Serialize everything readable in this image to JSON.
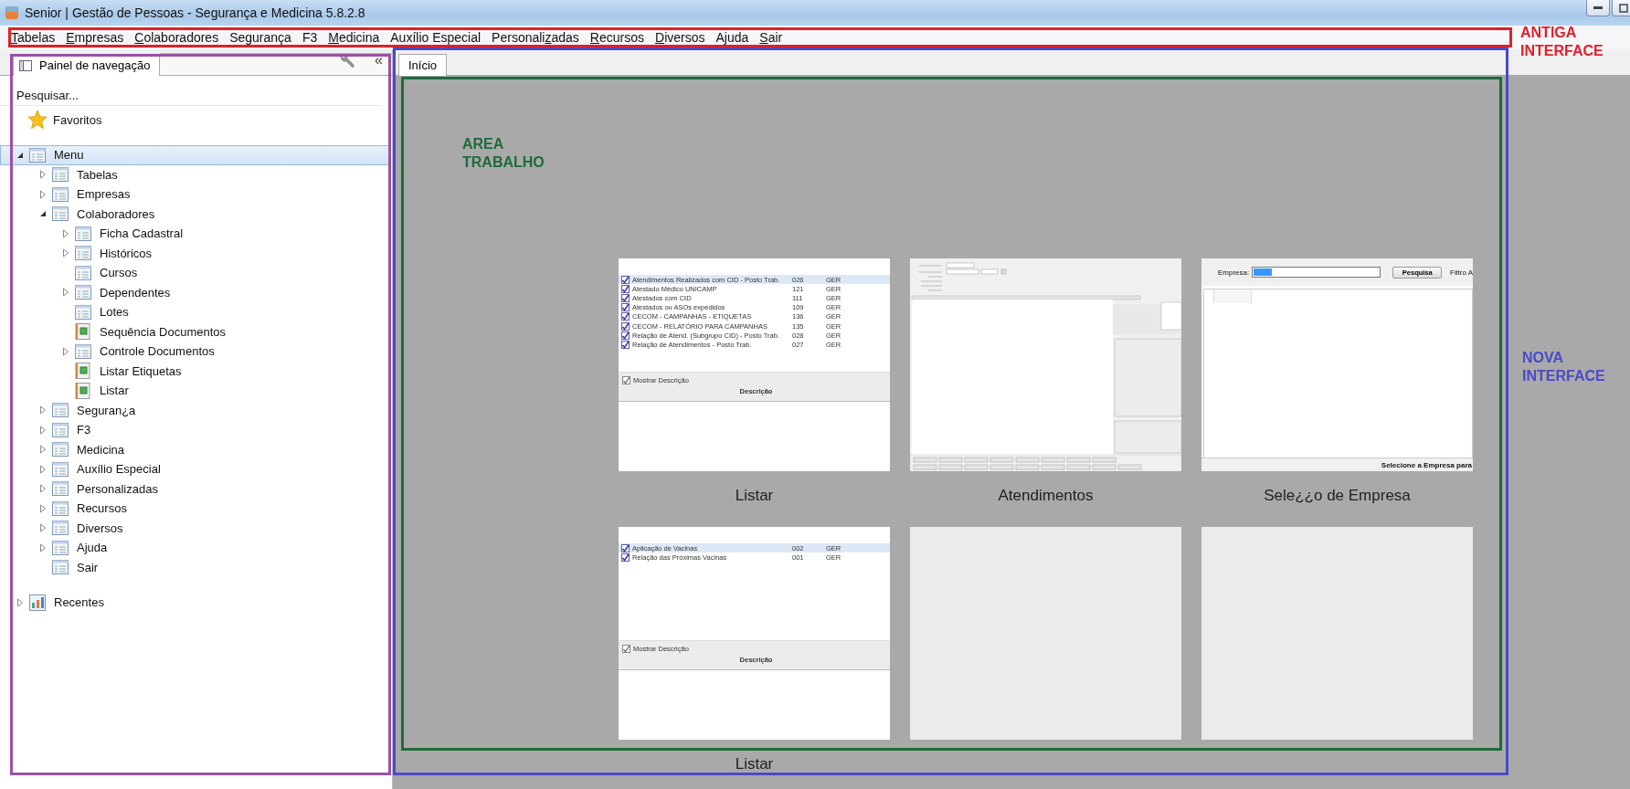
{
  "window": {
    "title": "Senior | Gestão de Pessoas - Segurança e Medicina 5.8.2.8"
  },
  "menubar": [
    {
      "key": "T",
      "after": "abelas"
    },
    {
      "key": "E",
      "after": "mpresas"
    },
    {
      "key": "C",
      "after": "olaboradores"
    },
    {
      "before": "Se",
      "key": "g",
      "after": "urança"
    },
    {
      "before": "F3"
    },
    {
      "key": "M",
      "after": "edicina"
    },
    {
      "before": "Auxílio Especial"
    },
    {
      "before": "Personali",
      "key": "z",
      "after": "adas"
    },
    {
      "key": "R",
      "after": "ecursos"
    },
    {
      "key": "D",
      "after": "iversos"
    },
    {
      "before": "A",
      "key": "j",
      "after": "uda"
    },
    {
      "key": "S",
      "after": "air"
    }
  ],
  "nav_panel": {
    "tab": "Painel de navegação",
    "collapse": "«",
    "search": {
      "placeholder": "Pesquisar..."
    },
    "favorites": "Favoritos",
    "tree": [
      {
        "label": "Menu",
        "kind": "branch",
        "expanded": true,
        "selected": true,
        "children": [
          {
            "label": "Tabelas",
            "kind": "branch",
            "expanded": false,
            "selected": false
          },
          {
            "label": "Empresas",
            "kind": "branch",
            "expanded": false,
            "selected": false
          },
          {
            "label": "Colaboradores",
            "kind": "branch",
            "expanded": true,
            "selected": false,
            "children": [
              {
                "label": "Ficha Cadastral",
                "kind": "branch",
                "expanded": false,
                "selected": false
              },
              {
                "label": "Históricos",
                "kind": "branch",
                "expanded": false,
                "selected": false
              },
              {
                "label": "Cursos",
                "kind": "leaf",
                "selected": false
              },
              {
                "label": "Dependentes",
                "kind": "branch",
                "expanded": false,
                "selected": false
              },
              {
                "label": "Lotes",
                "kind": "leaf",
                "selected": false
              },
              {
                "label": "Sequência Documentos",
                "kind": "report",
                "selected": false
              },
              {
                "label": "Controle Documentos",
                "kind": "branch",
                "expanded": false,
                "selected": false
              },
              {
                "label": "Listar Etiquetas",
                "kind": "report",
                "selected": false
              },
              {
                "label": "Listar",
                "kind": "report",
                "selected": false
              }
            ]
          },
          {
            "label": "Seguran¿a",
            "kind": "branch",
            "expanded": false,
            "selected": false
          },
          {
            "label": "F3",
            "kind": "branch",
            "expanded": false,
            "selected": false
          },
          {
            "label": "Medicina",
            "kind": "branch",
            "expanded": false,
            "selected": false
          },
          {
            "label": "Auxílio Especial",
            "kind": "branch",
            "expanded": false,
            "selected": false
          },
          {
            "label": "Personalizadas",
            "kind": "branch",
            "expanded": false,
            "selected": false
          },
          {
            "label": "Recursos",
            "kind": "branch",
            "expanded": false,
            "selected": false
          },
          {
            "label": "Diversos",
            "kind": "branch",
            "expanded": false,
            "selected": false
          },
          {
            "label": "Ajuda",
            "kind": "branch",
            "expanded": false,
            "selected": false
          },
          {
            "label": "Sair",
            "kind": "leaf",
            "selected": false
          }
        ]
      }
    ],
    "recent": {
      "label": "Recentes",
      "expanded": false
    }
  },
  "workspace": {
    "tabs": [
      {
        "label": "Início",
        "selected": true
      }
    ],
    "tiles": [
      {
        "kind": "report_list",
        "caption": "Listar",
        "rows": [
          {
            "name": "Atendimentos Realizados com CID - Posto Trab.",
            "code": "026",
            "group": "GER",
            "checked": true,
            "selected": true
          },
          {
            "name": "Atestado Médico UNICAMP",
            "code": "121",
            "group": "GER",
            "checked": true,
            "selected": false
          },
          {
            "name": "Atestados com CID",
            "code": "111",
            "group": "GER",
            "checked": true,
            "selected": false
          },
          {
            "name": "Atestados ou ASOs expedidos",
            "code": "109",
            "group": "GER",
            "checked": true,
            "selected": false
          },
          {
            "name": "CECOM - CAMPANHAS - ETIQUETAS",
            "code": "136",
            "group": "GER",
            "checked": true,
            "selected": false
          },
          {
            "name": "CECOM - RELATÓRIO PARA CAMPANHAS",
            "code": "135",
            "group": "GER",
            "checked": true,
            "selected": false
          },
          {
            "name": "Relação de Atend. (Subgrupo CID) - Posto Trab.",
            "code": "028",
            "group": "GER",
            "checked": true,
            "selected": false
          },
          {
            "name": "Relação de Atendimentos - Posto Trab.",
            "code": "027",
            "group": "GER",
            "checked": true,
            "selected": false
          }
        ],
        "show_description": {
          "label": "Mostrar Descrição",
          "checked": true
        },
        "description_header": "Descrição"
      },
      {
        "kind": "form",
        "caption": "Atendimentos"
      },
      {
        "kind": "company_search",
        "caption": "Sele¿¿o de Empresa",
        "field_label": "Empresa:",
        "button": "Pesquisa",
        "filter_label": "Filtro A",
        "status": "Selecione a Empresa para"
      },
      {
        "kind": "report_list",
        "caption": "Listar",
        "rows": [
          {
            "name": "Aplicação de Vacinas",
            "code": "002",
            "group": "GER",
            "checked": true,
            "selected": true
          },
          {
            "name": "Relação das Próximas Vacinas",
            "code": "001",
            "group": "GER",
            "checked": true,
            "selected": false
          }
        ],
        "show_description": {
          "label": "Mostrar Descrição",
          "checked": true
        },
        "description_header": "Descrição"
      },
      {
        "kind": "blank"
      },
      {
        "kind": "blank"
      }
    ]
  },
  "annotations": [
    {
      "kind": "old",
      "label": "ANTIGA INTERFACE",
      "color": "#e0202a"
    },
    {
      "kind": "new",
      "label": "NOVA INTERFACE",
      "color": "#4a4ac8"
    },
    {
      "kind": "panel",
      "color": "#9b4fa8"
    },
    {
      "kind": "work",
      "label": "AREA TRABALHO",
      "color": "#1e6b3a"
    }
  ]
}
